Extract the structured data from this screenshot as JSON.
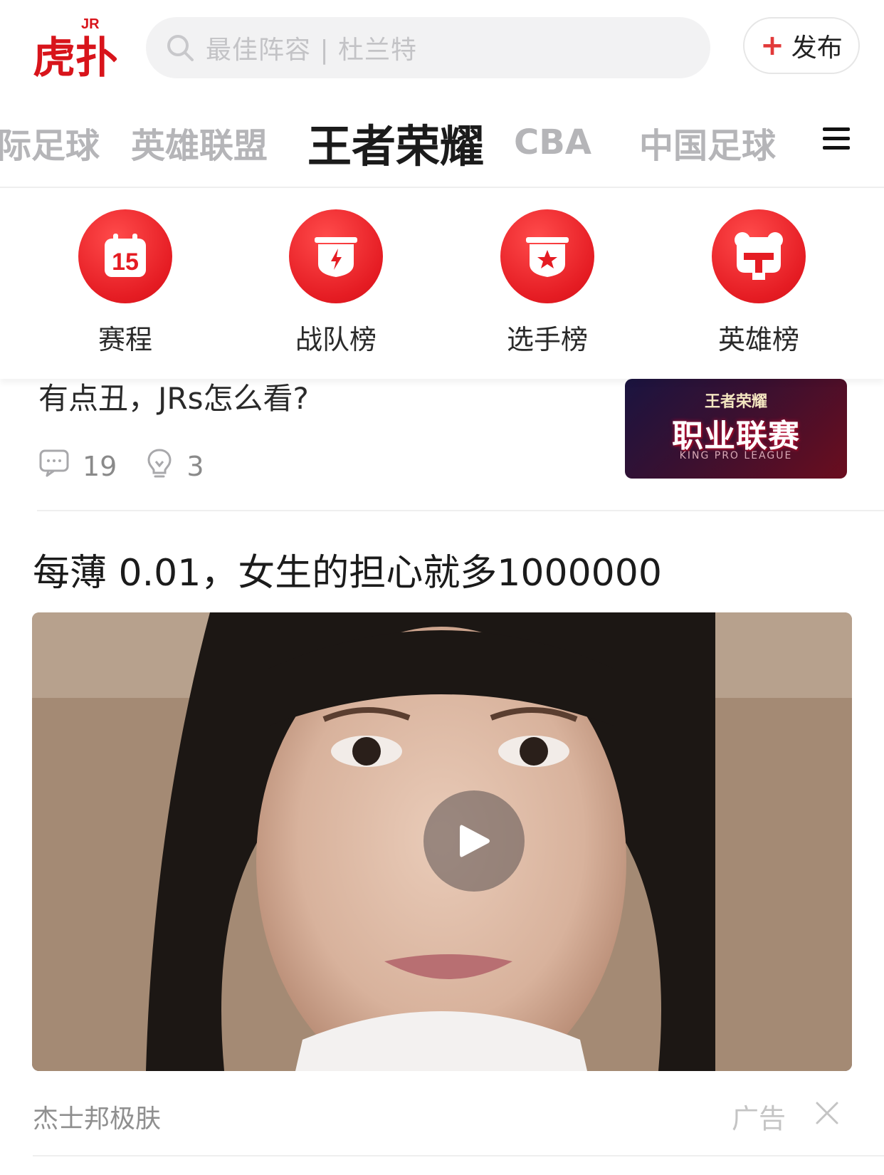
{
  "header": {
    "search_placeholder": "最佳阵容 | 杜兰特",
    "publish_label": "发布",
    "logo_text": "虎扑 JR"
  },
  "tabs": [
    {
      "label": "际足球",
      "active": false
    },
    {
      "label": "英雄联盟",
      "active": false
    },
    {
      "label": "王者荣耀",
      "active": true
    },
    {
      "label": "CBA",
      "active": false
    },
    {
      "label": "中国足球",
      "active": false
    }
  ],
  "quick_entries": [
    {
      "label": "赛程",
      "icon": "calendar-15-icon"
    },
    {
      "label": "战队榜",
      "icon": "team-shield-icon"
    },
    {
      "label": "选手榜",
      "icon": "player-star-icon"
    },
    {
      "label": "英雄榜",
      "icon": "hero-bear-icon"
    }
  ],
  "prev_post": {
    "title_tail": "有点丑，JRs怎么看?",
    "comments": "19",
    "likes": "3",
    "thumb_line1": "王者荣耀",
    "thumb_line2": "职业联赛",
    "thumb_line3": "KING PRO LEAGUE"
  },
  "ad_post": {
    "title": "每薄 0.01，女生的担心就多1000000",
    "source": "杰士邦极肤",
    "tag": "广告"
  },
  "colors": {
    "brand_red": "#e51c23",
    "tab_active": "#1b1b1b",
    "tab_inactive": "#b5b5b8"
  }
}
